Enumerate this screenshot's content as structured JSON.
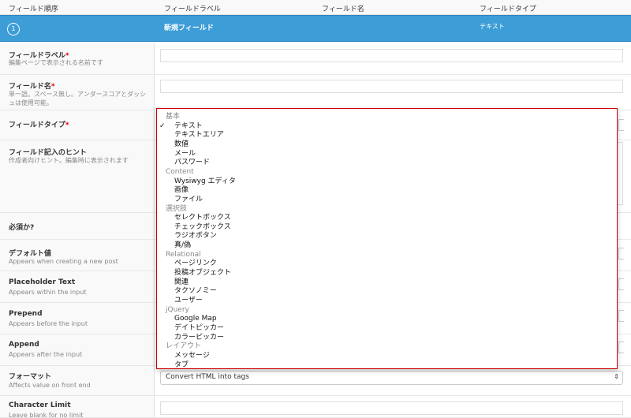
{
  "header": {
    "col_order": "フィールド順序",
    "col_label": "フィールドラベル",
    "col_name": "フィールド名",
    "col_type": "フィールドタイプ"
  },
  "field_bar": {
    "order": "1",
    "label": "新規フィールド",
    "type": "テキスト"
  },
  "form": {
    "label": {
      "title": "フィールドラベル",
      "required": "*",
      "desc": "編集ページで表示される名前です"
    },
    "name": {
      "title": "フィールド名",
      "required": "*",
      "desc": "単一語。スペース無し。アンダースコアとダッシュは使用可能。"
    },
    "type": {
      "title": "フィールドタイプ",
      "required": "*"
    },
    "hint": {
      "title": "フィールド記入のヒント",
      "desc": "作成者向けヒント。編集時に表示されます"
    },
    "required_q": {
      "title": "必須か?"
    },
    "default": {
      "title": "デフォルト値",
      "desc": "Appears when creating a new post"
    },
    "placeholder": {
      "title": "Placeholder Text",
      "desc": "Appears within the input"
    },
    "prepend": {
      "title": "Prepend",
      "desc": "Appears before the input"
    },
    "append": {
      "title": "Append",
      "desc": "Appears after the input"
    },
    "format": {
      "title": "フォーマット",
      "desc": "Affects value on front end",
      "value": "Convert HTML into tags"
    },
    "char_limit": {
      "title": "Character Limit",
      "desc": "Leave blank for no limit"
    }
  },
  "dropdown": {
    "checkmark": "✓",
    "groups": [
      {
        "label": "基本",
        "options": [
          "テキスト",
          "テキストエリア",
          "数値",
          "メール",
          "パスワード"
        ]
      },
      {
        "label": "Content",
        "options": [
          "Wysiwyg エディタ",
          "画像",
          "ファイル"
        ]
      },
      {
        "label": "選択肢",
        "options": [
          "セレクトボックス",
          "チェックボックス",
          "ラジオボタン",
          "真/偽"
        ]
      },
      {
        "label": "Relational",
        "options": [
          "ページリンク",
          "投稿オブジェクト",
          "関連",
          "タクソノミー",
          "ユーザー"
        ]
      },
      {
        "label": "jQuery",
        "options": [
          "Google Map",
          "デイトピッカー",
          "カラーピッカー"
        ]
      },
      {
        "label": "レイアウト",
        "options": [
          "メッセージ",
          "タブ"
        ]
      }
    ]
  }
}
